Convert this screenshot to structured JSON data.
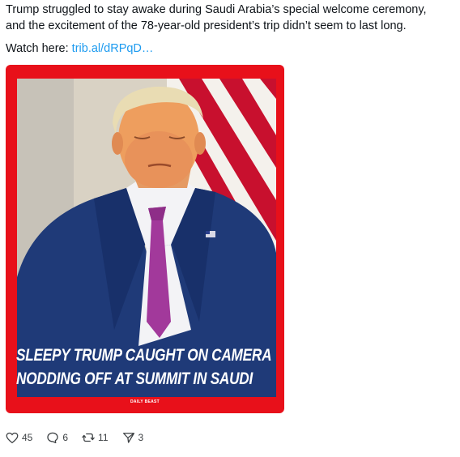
{
  "post": {
    "text_line1": "Trump struggled to stay awake during Saudi Arabia’s special welcome ceremony,",
    "text_line2": "and the excitement of the 78-year-old president’s trip didn’t seem to last long.",
    "watch_prefix": "Watch here:",
    "link_text": "trib.al/dRPqD…"
  },
  "media": {
    "headline_line1": "SLEEPY TRUMP CAUGHT ON CAMERA",
    "headline_line2": "NODDING OFF AT SUMMIT IN SAUDI",
    "brand": "DAILY BEAST",
    "card_color": "#e8101a"
  },
  "actions": {
    "likes": "45",
    "replies": "6",
    "reposts": "11",
    "shares": "3",
    "icons": [
      "heart-icon",
      "reply-icon",
      "repost-icon",
      "share-icon"
    ]
  }
}
